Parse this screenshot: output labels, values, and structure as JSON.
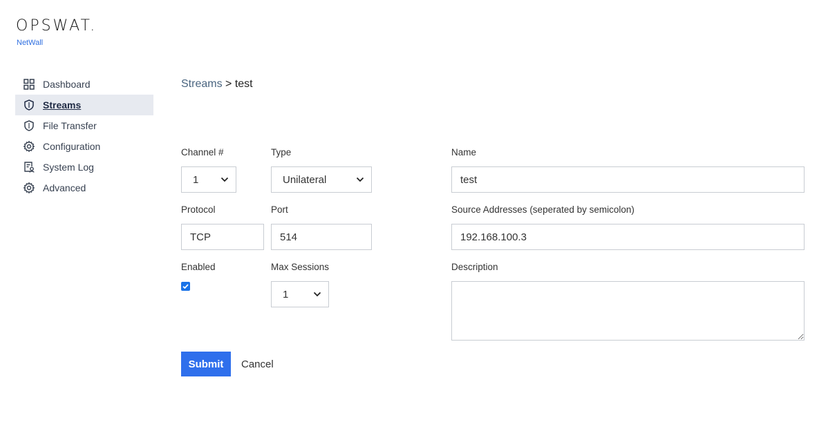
{
  "brand": {
    "name": "OPSWAT.",
    "product": "NetWall"
  },
  "sidebar": {
    "items": [
      {
        "label": "Dashboard",
        "icon": "grid-icon"
      },
      {
        "label": "Streams",
        "icon": "shield-icon",
        "active": true
      },
      {
        "label": "File Transfer",
        "icon": "shield-icon"
      },
      {
        "label": "Configuration",
        "icon": "gear-icon"
      },
      {
        "label": "System Log",
        "icon": "log-icon"
      },
      {
        "label": "Advanced",
        "icon": "gear-icon"
      }
    ]
  },
  "breadcrumb": {
    "parent": "Streams",
    "separator": ">",
    "current": "test"
  },
  "form": {
    "channel": {
      "label": "Channel #",
      "value": "1"
    },
    "type": {
      "label": "Type",
      "value": "Unilateral"
    },
    "name": {
      "label": "Name",
      "value": "test"
    },
    "protocol": {
      "label": "Protocol",
      "value": "TCP"
    },
    "port": {
      "label": "Port",
      "value": "514"
    },
    "source": {
      "label": "Source Addresses (seperated by semicolon)",
      "value": "192.168.100.3"
    },
    "enabled": {
      "label": "Enabled",
      "checked": true
    },
    "max_sessions": {
      "label": "Max Sessions",
      "value": "1"
    },
    "description": {
      "label": "Description",
      "value": ""
    },
    "submit_label": "Submit",
    "cancel_label": "Cancel"
  },
  "colors": {
    "accent": "#2f6fec",
    "brand_sub": "#2f6fe0",
    "active_bg": "#e7eaf0"
  }
}
